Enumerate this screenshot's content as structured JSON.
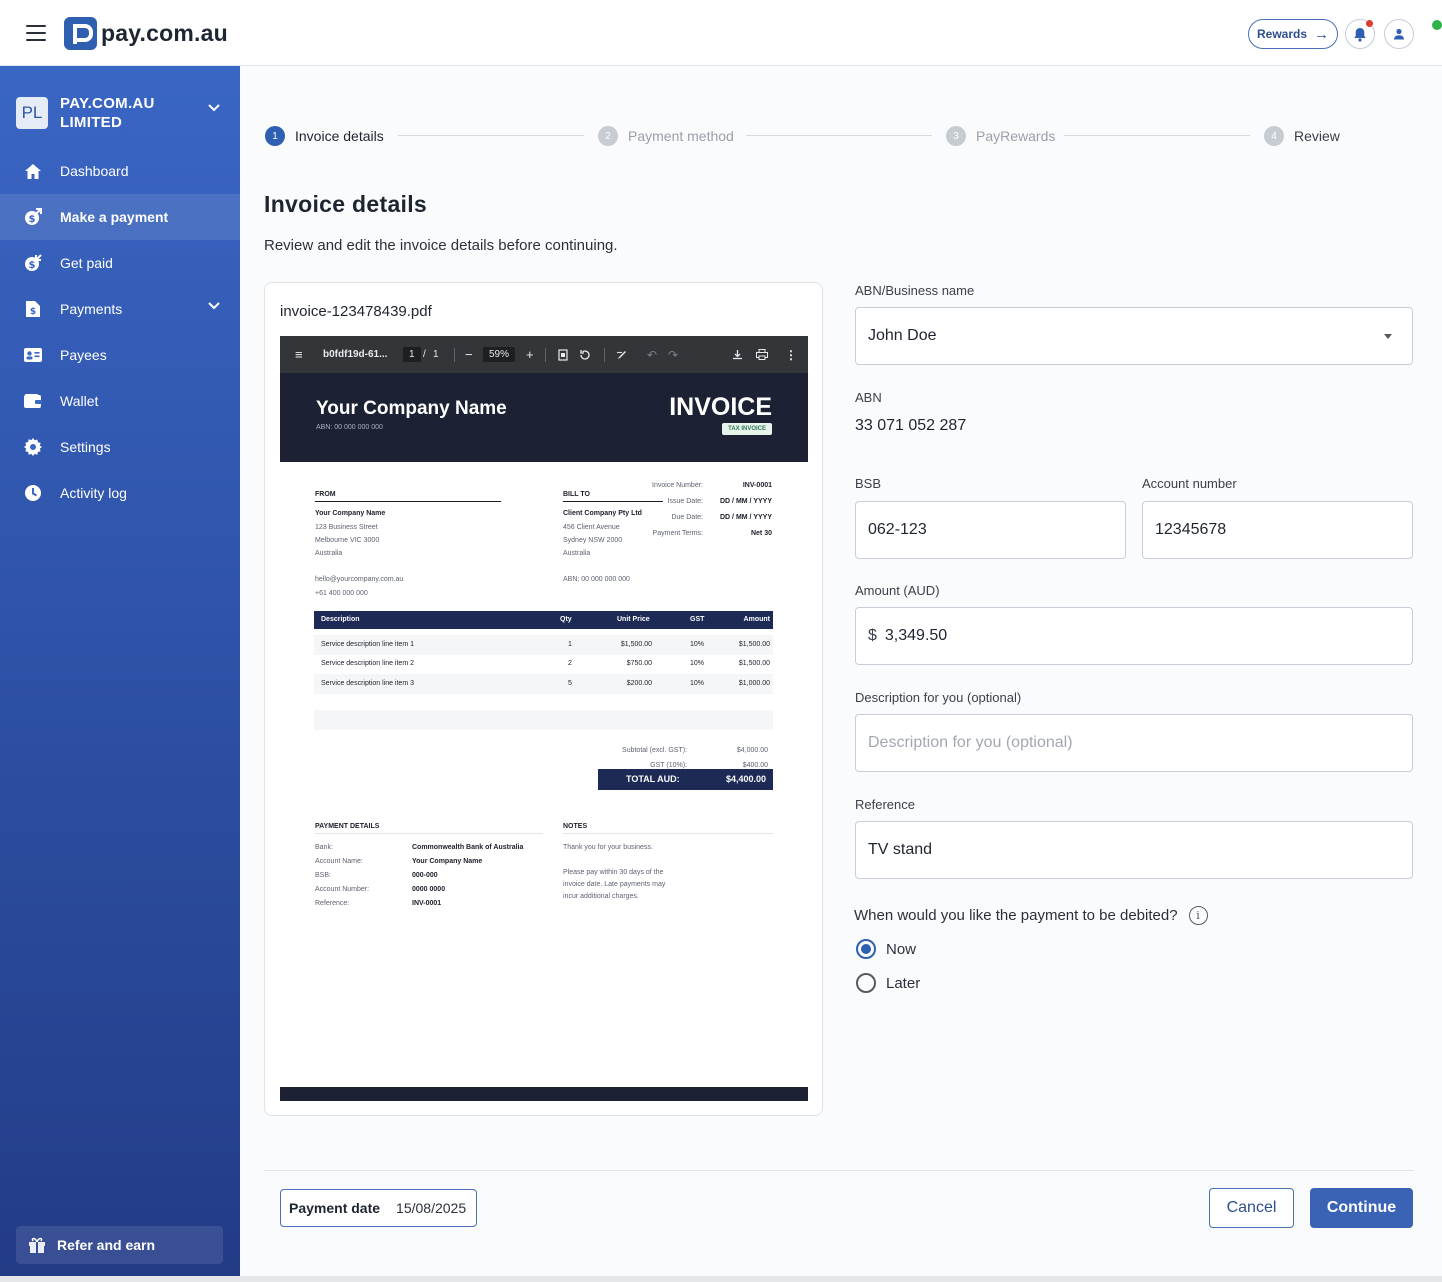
{
  "header": {
    "brand": "pay.com.au",
    "rewards_label": "Rewards"
  },
  "sidebar": {
    "org_initials": "PL",
    "org_name": "PAY.COM.AU LIMITED",
    "items": [
      {
        "label": "Dashboard",
        "icon": "home-icon"
      },
      {
        "label": "Make a payment",
        "icon": "send-money-icon",
        "active": true
      },
      {
        "label": "Get paid",
        "icon": "receive-money-icon"
      },
      {
        "label": "Payments",
        "icon": "document-dollar-icon",
        "expandable": true
      },
      {
        "label": "Payees",
        "icon": "contact-card-icon"
      },
      {
        "label": "Wallet",
        "icon": "wallet-icon"
      },
      {
        "label": "Settings",
        "icon": "gear-icon"
      },
      {
        "label": "Activity log",
        "icon": "clock-icon"
      }
    ],
    "refer_label": "Refer and earn"
  },
  "stepper": {
    "steps": [
      {
        "num": "1",
        "label": "Invoice details",
        "state": "current"
      },
      {
        "num": "2",
        "label": "Payment method",
        "state": "future"
      },
      {
        "num": "3",
        "label": "PayRewards",
        "state": "future"
      },
      {
        "num": "4",
        "label": "Review",
        "state": "future"
      }
    ]
  },
  "page": {
    "title": "Invoice details",
    "subtitle": "Review and edit the invoice details before continuing."
  },
  "pdf": {
    "filename": "invoice-123478439.pdf",
    "toolbar": {
      "doc_name": "b0fdf19d-61...",
      "page_current": "1",
      "page_sep": "/",
      "page_total": "1",
      "zoom": "59%"
    },
    "invoice": {
      "company": "Your Company Name",
      "company_abn": "ABN: 00 000 000 000",
      "title": "INVOICE",
      "badge": "TAX INVOICE",
      "meta_labels": [
        "Invoice Number:",
        "Issue Date:",
        "Due Date:",
        "Payment Terms:"
      ],
      "meta_values": [
        "INV-0001",
        "DD / MM / YYYY",
        "DD / MM / YYYY",
        "Net 30"
      ],
      "from_heading": "FROM",
      "from_lines": [
        "Your Company Name",
        "123 Business Street",
        "Melbourne VIC 3000",
        "Australia",
        "hello@yourcompany.com.au",
        "+61 400 000 000"
      ],
      "bill_heading": "BILL TO",
      "bill_lines": [
        "Client Company Pty Ltd",
        "456 Client Avenue",
        "Sydney NSW 2000",
        "Australia",
        "ABN: 00 000 000 000"
      ],
      "columns": [
        "Description",
        "Qty",
        "Unit Price",
        "GST",
        "Amount"
      ],
      "rows": [
        [
          "Service description line item 1",
          "1",
          "$1,500.00",
          "10%",
          "$1,500.00"
        ],
        [
          "Service description line item 2",
          "2",
          "$750.00",
          "10%",
          "$1,500.00"
        ],
        [
          "Service description line item 3",
          "5",
          "$200.00",
          "10%",
          "$1,000.00"
        ]
      ],
      "subtotal_label": "Subtotal (excl. GST):",
      "subtotal_value": "$4,000.00",
      "gst_label": "GST (10%):",
      "gst_value": "$400.00",
      "total_label": "TOTAL AUD:",
      "total_value": "$4,400.00",
      "pay_heading": "PAYMENT DETAILS",
      "pay_labels": [
        "Bank:",
        "Account Name:",
        "BSB:",
        "Account Number:",
        "Reference:"
      ],
      "pay_values": [
        "Commonwealth Bank of Australia",
        "Your Company Name",
        "000-000",
        "0000 0000",
        "INV-0001"
      ],
      "notes_heading": "NOTES",
      "notes_lines": [
        "Thank you for your business.",
        "Please pay within 30 days of the",
        "invoice date. Late payments may",
        "incur additional charges."
      ]
    }
  },
  "form": {
    "business_label": "ABN/Business name",
    "business_value": "John Doe",
    "abn_label": "ABN",
    "abn_value": "33 071 052 287",
    "bsb_label": "BSB",
    "bsb_value": "062-123",
    "account_label": "Account number",
    "account_value": "12345678",
    "amount_label": "Amount (AUD)",
    "amount_currency": "$",
    "amount_value": "3,349.50",
    "desc_label": "Description for you (optional)",
    "desc_placeholder": "Description for you (optional)",
    "reference_label": "Reference",
    "reference_value": "TV stand",
    "debit_question": "When would you like the payment to be debited?",
    "debit_options": [
      {
        "label": "Now",
        "selected": true
      },
      {
        "label": "Later",
        "selected": false
      }
    ]
  },
  "footer": {
    "payment_date_label": "Payment date",
    "payment_date_value": "15/08/2025",
    "cancel_label": "Cancel",
    "continue_label": "Continue"
  },
  "colors": {
    "brand": "#2f5fb0",
    "sidebar_top": "#3a66c4",
    "sidebar_bottom": "#233b86",
    "notification": "#e0392f",
    "online": "#2db34a"
  }
}
